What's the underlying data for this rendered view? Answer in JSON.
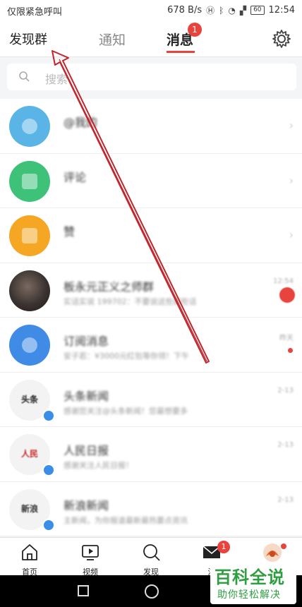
{
  "status_bar": {
    "carrier": "仅限紧急呼叫",
    "speed": "678 B/s",
    "battery": "60",
    "time": "12:54"
  },
  "header": {
    "discover_group": "发现群",
    "tab_notify": "通知",
    "tab_messages": "消息",
    "messages_badge": "1"
  },
  "search": {
    "placeholder": "搜索"
  },
  "messages": [
    {
      "title": "@我的",
      "subtitle": "",
      "time": "",
      "avatar_color": "#5bb4e6",
      "type": "system"
    },
    {
      "title": "评论",
      "subtitle": "",
      "time": "",
      "avatar_color": "#3ec27a",
      "type": "system"
    },
    {
      "title": "赞",
      "subtitle": "",
      "time": "",
      "avatar_color": "#f5a623",
      "type": "system"
    },
    {
      "title": "板永元正义之师群",
      "subtitle": "实话实说 199702：不要说这些那些话",
      "time": "12:54",
      "type": "photo",
      "indicator": "count"
    },
    {
      "title": "订阅消息",
      "subtitle": "安子若：¥3000元红包等你领！下午",
      "time": "昨天",
      "avatar_color": "#3f8be6",
      "type": "system",
      "indicator": "dot"
    },
    {
      "title": "头条新闻",
      "subtitle": "感谢您关注@头条新闻！您最想要多",
      "time": "2-13",
      "type": "logo",
      "verified": true
    },
    {
      "title": "人民日报",
      "subtitle": "感谢关注人民日报！",
      "time": "2-13",
      "type": "logo",
      "verified": true
    },
    {
      "title": "新浪新闻",
      "subtitle": "主新闻，为你报道最新最热要点资讯",
      "time": "2-13",
      "type": "logo",
      "verified": true
    }
  ],
  "bottom_nav": {
    "home": "首页",
    "video": "视频",
    "discover": "发现",
    "messages": "消",
    "messages_badge": "1"
  },
  "watermark": {
    "title": "百科全说",
    "subtitle": "助你轻松解决"
  }
}
